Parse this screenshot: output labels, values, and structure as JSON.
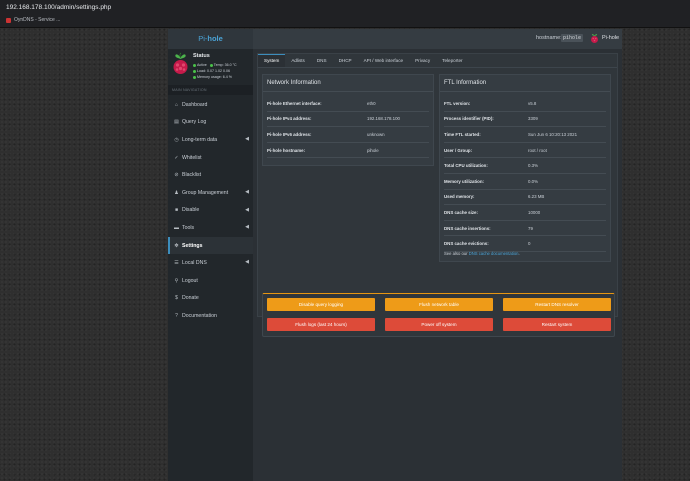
{
  "browser": {
    "url": "192.168.178.100/admin/settings.php",
    "bookmark": "OynDNS - Service ..."
  },
  "navbar": {
    "brand_prefix": "Pi-",
    "brand_suffix": "hole",
    "hostname_label": "hostname:",
    "hostname": "pihole",
    "product": "Pi-hole"
  },
  "sidebar": {
    "status_title": "Status",
    "status_active": "Active",
    "status_temp": "Temp: 36.0 °C",
    "status_load": "Load: 0.07  1.02  0.06",
    "status_memory": "Memory usage: 6.4 %",
    "section_header": "MAIN NAVIGATION",
    "items": [
      {
        "label": "Dashboard",
        "icon": "home-icon",
        "glyph": "⌂",
        "chevron": false
      },
      {
        "label": "Query Log",
        "icon": "file-icon",
        "glyph": "▤",
        "chevron": false
      },
      {
        "label": "Long-term data",
        "icon": "history-icon",
        "glyph": "◷",
        "chevron": true
      },
      {
        "label": "Whitelist",
        "icon": "check-circle-icon",
        "glyph": "✓",
        "chevron": false
      },
      {
        "label": "Blacklist",
        "icon": "ban-icon",
        "glyph": "⊘",
        "chevron": false
      },
      {
        "label": "Group Management",
        "icon": "users-icon",
        "glyph": "♟",
        "chevron": true
      },
      {
        "label": "Disable",
        "icon": "stop-icon",
        "glyph": "■",
        "chevron": true
      },
      {
        "label": "Tools",
        "icon": "folder-icon",
        "glyph": "▬",
        "chevron": true
      },
      {
        "label": "Settings",
        "icon": "gears-icon",
        "glyph": "✲",
        "chevron": false
      },
      {
        "label": "Local DNS",
        "icon": "address-book-icon",
        "glyph": "☰",
        "chevron": true
      },
      {
        "label": "Logout",
        "icon": "user-icon",
        "glyph": "⚲",
        "chevron": false
      },
      {
        "label": "Donate",
        "icon": "donate-icon",
        "glyph": "$",
        "chevron": false
      },
      {
        "label": "Documentation",
        "icon": "question-circle-icon",
        "glyph": "?",
        "chevron": false
      }
    ]
  },
  "tabs": [
    "System",
    "Adlists",
    "DNS",
    "DHCP",
    "API / Web interface",
    "Privacy",
    "Teleporter"
  ],
  "network": {
    "title": "Network Information",
    "rows": [
      {
        "label": "Pi-hole Ethernet interface:",
        "value": "eth0"
      },
      {
        "label": "Pi-hole IPv4 address:",
        "value": "192.168.178.100"
      },
      {
        "label": "Pi-hole IPv6 address:",
        "value": "unknown"
      },
      {
        "label": "Pi-hole hostname:",
        "value": "pihole"
      }
    ]
  },
  "ftl": {
    "title": "FTL Information",
    "rows": [
      {
        "label": "FTL version:",
        "value": "v5.8"
      },
      {
        "label": "Process identifier (PID):",
        "value": "3309"
      },
      {
        "label": "Time FTL started:",
        "value": "Sun Jun 6 10:20:13 2021"
      },
      {
        "label": "User / Group:",
        "value": "root / root"
      },
      {
        "label": "Total CPU utilization:",
        "value": "0.3%"
      },
      {
        "label": "Memory utilization:",
        "value": "0.0%"
      },
      {
        "label": "Used memory:",
        "value": "6.23 MB"
      },
      {
        "label": "DNS cache size:",
        "value": "10000"
      },
      {
        "label": "DNS cache insertions:",
        "value": "79"
      },
      {
        "label": "DNS cache evictions:",
        "value": "0"
      }
    ],
    "note_prefix": "See also our ",
    "note_link": "DNS cache documentation",
    "note_suffix": "."
  },
  "actions": {
    "disable_query_logging": "Disable query logging",
    "flush_network_table": "Flush network table",
    "restart_dns": "Restart DNS resolver",
    "flush_logs": "Flush logs (last 24 hours)",
    "power_off": "Power off system",
    "restart_system": "Restart system"
  },
  "colors": {
    "accent": "#3c8dbc",
    "warning": "#ee9b18",
    "danger": "#dd4b39",
    "status_green": "#4ac24a"
  }
}
